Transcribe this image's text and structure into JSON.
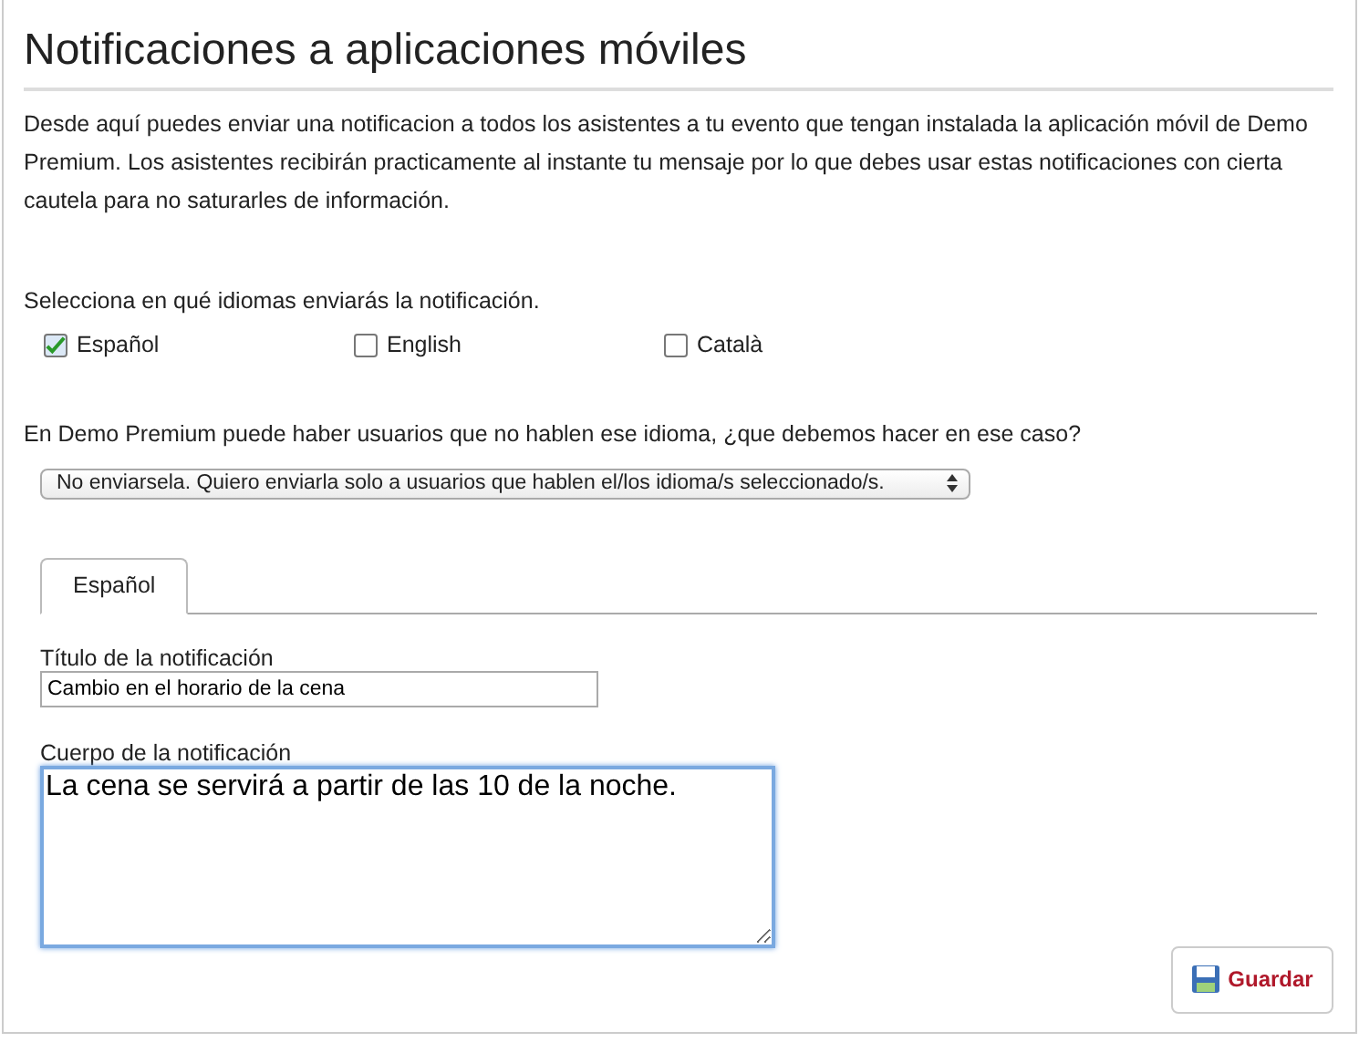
{
  "title": "Notificaciones a aplicaciones móviles",
  "intro": "Desde aquí puedes enviar una notificacion a todos los asistentes a tu evento que tengan instalada la aplicación móvil de Demo Premium. Los asistentes recibirán practicamente al instante tu mensaje por lo que debes usar estas notificaciones con cierta cautela para no saturarles de información.",
  "languages_label": "Selecciona en qué idiomas enviarás la notificación.",
  "languages": [
    {
      "label": "Español",
      "checked": true
    },
    {
      "label": "English",
      "checked": false
    },
    {
      "label": "Català",
      "checked": false
    }
  ],
  "fallback_label": "En Demo Premium puede haber usuarios que no hablen ese idioma, ¿que debemos hacer en ese caso?",
  "fallback_select": {
    "value": "No enviarsela. Quiero enviarla solo a usuarios que hablen el/los idioma/s seleccionado/s."
  },
  "tabs": [
    {
      "label": "Español",
      "selected": true
    }
  ],
  "title_field": {
    "label": "Título de la notificación",
    "value": "Cambio en el horario de la cena"
  },
  "body_field": {
    "label": "Cuerpo de la notificación",
    "value": "La cena se servirá a partir de las 10 de la noche."
  },
  "save_button": {
    "label": "Guardar"
  }
}
